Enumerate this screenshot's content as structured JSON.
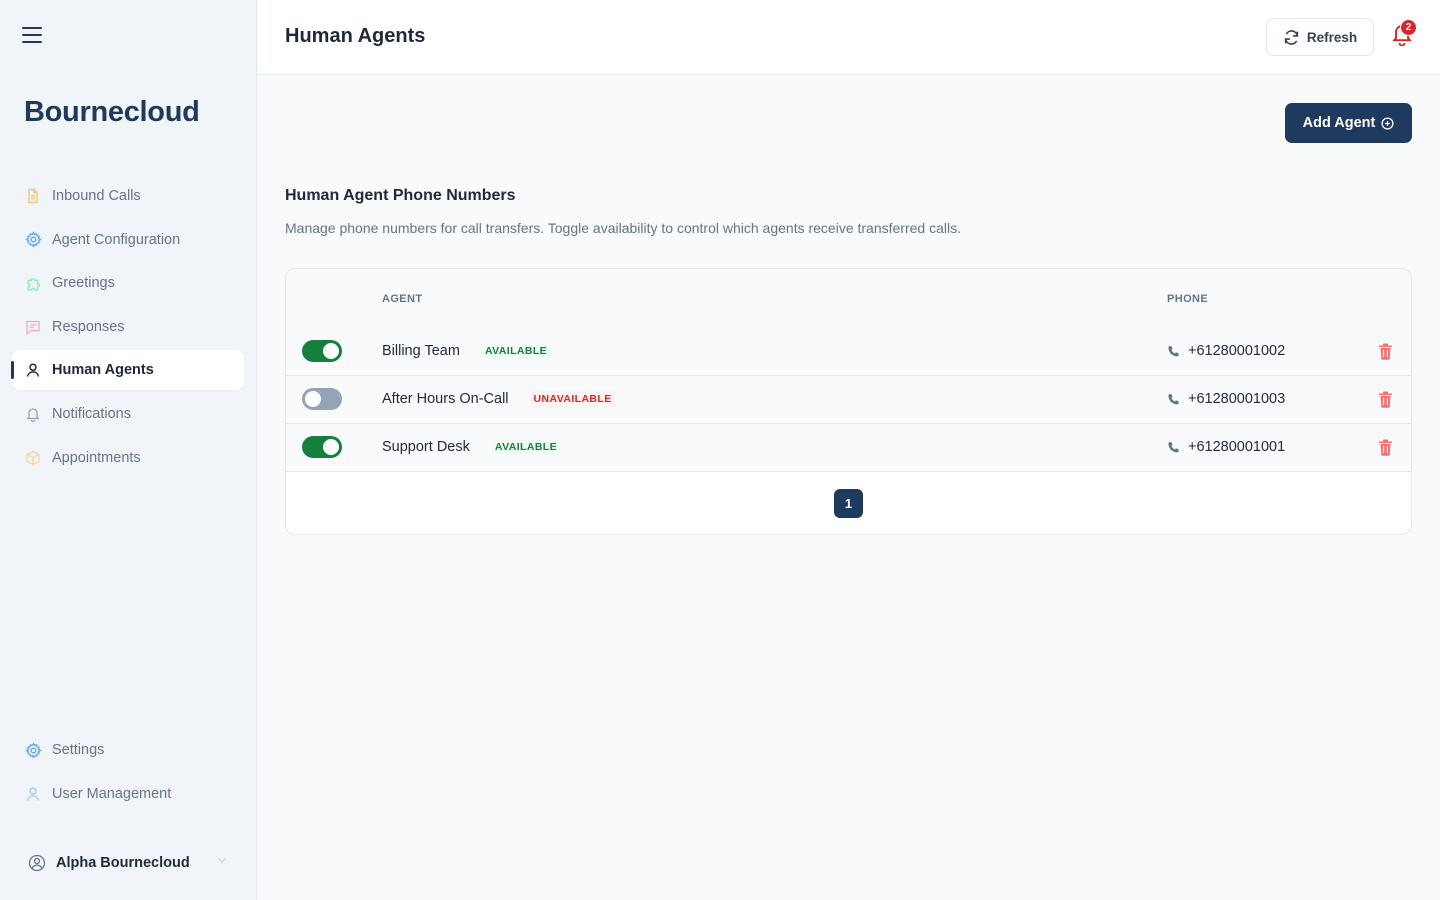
{
  "sidebar": {
    "brand": "Bournecloud",
    "items": [
      {
        "label": "Inbound Calls",
        "icon": "document-icon"
      },
      {
        "label": "Agent Configuration",
        "icon": "gear-icon"
      },
      {
        "label": "Greetings",
        "icon": "puzzle-icon"
      },
      {
        "label": "Responses",
        "icon": "chat-icon"
      },
      {
        "label": "Human Agents",
        "icon": "user-icon",
        "active": true
      },
      {
        "label": "Notifications",
        "icon": "bell-icon"
      },
      {
        "label": "Appointments",
        "icon": "cube-icon"
      }
    ],
    "bottom_items": [
      {
        "label": "Settings",
        "icon": "gear-icon"
      },
      {
        "label": "User Management",
        "icon": "user-icon"
      }
    ],
    "user": {
      "name": "Alpha Bournecloud"
    }
  },
  "header": {
    "title": "Human Agents",
    "refresh_label": "Refresh",
    "notification_count": "2"
  },
  "main": {
    "add_button_label": "Add Agent",
    "section_title": "Human Agent Phone Numbers",
    "section_description": "Manage phone numbers for call transfers. Toggle availability to control which agents receive transferred calls.",
    "table": {
      "columns": {
        "agent": "AGENT",
        "phone": "PHONE"
      },
      "rows": [
        {
          "enabled": true,
          "name": "Billing Team",
          "status": "AVAILABLE",
          "phone": "+61280001002"
        },
        {
          "enabled": false,
          "name": "After Hours On-Call",
          "status": "UNAVAILABLE",
          "phone": "+61280001003"
        },
        {
          "enabled": true,
          "name": "Support Desk",
          "status": "AVAILABLE",
          "phone": "+61280001001"
        }
      ]
    },
    "pagination": {
      "current": "1"
    }
  },
  "colors": {
    "brand": "#1e3a5f",
    "available": "#15803d",
    "unavailable": "#dc2626",
    "toggle_off": "#94a3b8",
    "trash": "#f87171"
  }
}
